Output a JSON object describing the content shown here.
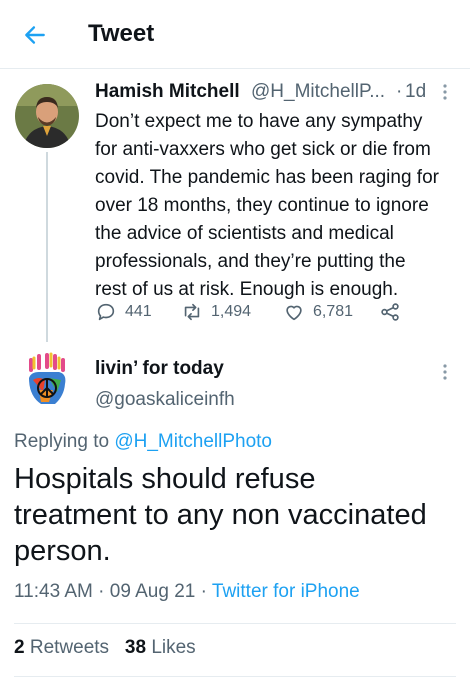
{
  "header": {
    "title": "Tweet"
  },
  "colors": {
    "accent": "#1da1f2",
    "secondary_text": "#536471"
  },
  "parent_tweet": {
    "display_name": "Hamish Mitchell",
    "handle": "@H_MitchellP...",
    "separator": "·",
    "time": "1d",
    "lines": [
      "Don’t expect me to have any sympathy",
      "for anti-vaxxers who get sick or die from",
      "covid. The pandemic has been raging for",
      "over 18 months, they continue to ignore",
      "the advice of scientists and medical",
      "professionals, and they’re putting the",
      "rest of us at risk. Enough is enough."
    ],
    "replies": "441",
    "retweets": "1,494",
    "likes": "6,781"
  },
  "reply_tweet": {
    "display_name": "livin’ for today",
    "handle": "@goaskaliceinfh",
    "replying_prefix": "Replying to",
    "replying_handle": "@H_MitchellPhoto",
    "lines": [
      "Hospitals should refuse",
      "treatment to any non vaccinated",
      "person."
    ],
    "timestamp": "11:43 AM · 09 Aug 21 · ",
    "source": "Twitter for iPhone"
  },
  "stats": {
    "retweets_count": "2",
    "retweets_label": "Retweets",
    "likes_count": "38",
    "likes_label": "Likes"
  }
}
